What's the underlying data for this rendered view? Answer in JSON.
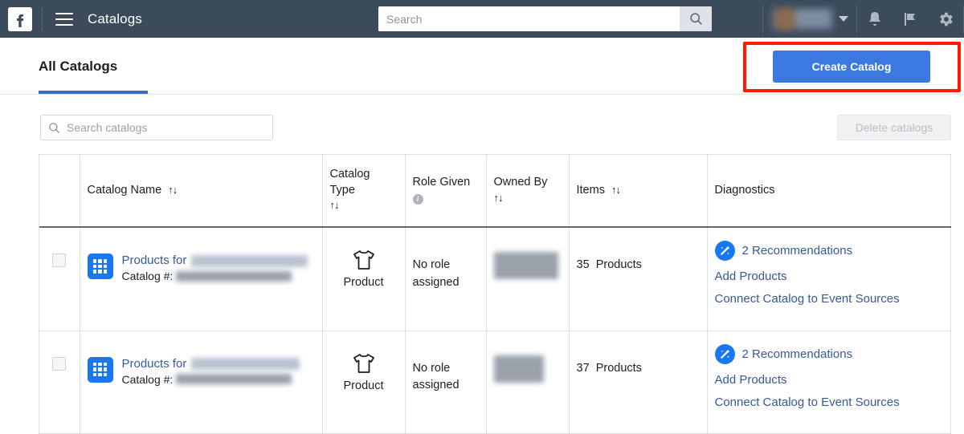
{
  "topbar": {
    "logo_alt": "facebook-logo",
    "menu_icon": "hamburger-menu-icon",
    "title": "Catalogs",
    "search_placeholder": "Search",
    "search_value": "",
    "search_button_icon": "search-icon",
    "account_label": "",
    "caret_icon": "chevron-down-icon",
    "icons": [
      "bell-icon",
      "flag-icon",
      "gear-icon"
    ]
  },
  "tabs": {
    "items": [
      {
        "label": "All Catalogs",
        "active": true
      }
    ],
    "create_button": "Create Catalog",
    "accent_color": "#3b79e0",
    "underline_color": "#3a6bc4",
    "annotation_color": "#ff1a00"
  },
  "toolbar": {
    "search_placeholder": "Search catalogs",
    "search_value": "",
    "search_icon": "search-icon",
    "delete_label": "Delete catalogs",
    "delete_disabled": true
  },
  "table": {
    "columns": [
      {
        "key": "checkbox",
        "label": "",
        "sortable": false
      },
      {
        "key": "name",
        "label": "Catalog Name",
        "sort": "↑↓"
      },
      {
        "key": "type",
        "label": "Catalog Type",
        "sort": "↑↓"
      },
      {
        "key": "role",
        "label": "Role Given",
        "info": true
      },
      {
        "key": "owner",
        "label": "Owned By",
        "sort": "↑↓"
      },
      {
        "key": "items",
        "label": "Items",
        "sort": "↑↓"
      },
      {
        "key": "diagnostics",
        "label": "Diagnostics",
        "sortable": false
      }
    ],
    "rows": [
      {
        "icon": "catalog-grid-icon",
        "name_prefix": "Products for",
        "name_redacted": true,
        "catalog_number_label": "Catalog #:",
        "catalog_number_redacted": true,
        "type_icon": "tshirt-icon",
        "type": "Product",
        "role": "No role assigned",
        "owner_redacted": true,
        "items_count": "35",
        "items_unit": "Products",
        "diagnostics": {
          "badge_icon": "magic-wand-icon",
          "recommendations": "2 Recommendations",
          "links": [
            "Add Products",
            "Connect Catalog to Event Sources"
          ]
        }
      },
      {
        "icon": "catalog-grid-icon",
        "name_prefix": "Products for",
        "name_redacted": true,
        "catalog_number_label": "Catalog #:",
        "catalog_number_redacted": true,
        "type_icon": "tshirt-icon",
        "type": "Product",
        "role": "No role assigned",
        "owner_redacted": true,
        "items_count": "37",
        "items_unit": "Products",
        "diagnostics": {
          "badge_icon": "magic-wand-icon",
          "recommendations": "2 Recommendations",
          "links": [
            "Add Products",
            "Connect Catalog to Event Sources"
          ]
        }
      }
    ]
  }
}
